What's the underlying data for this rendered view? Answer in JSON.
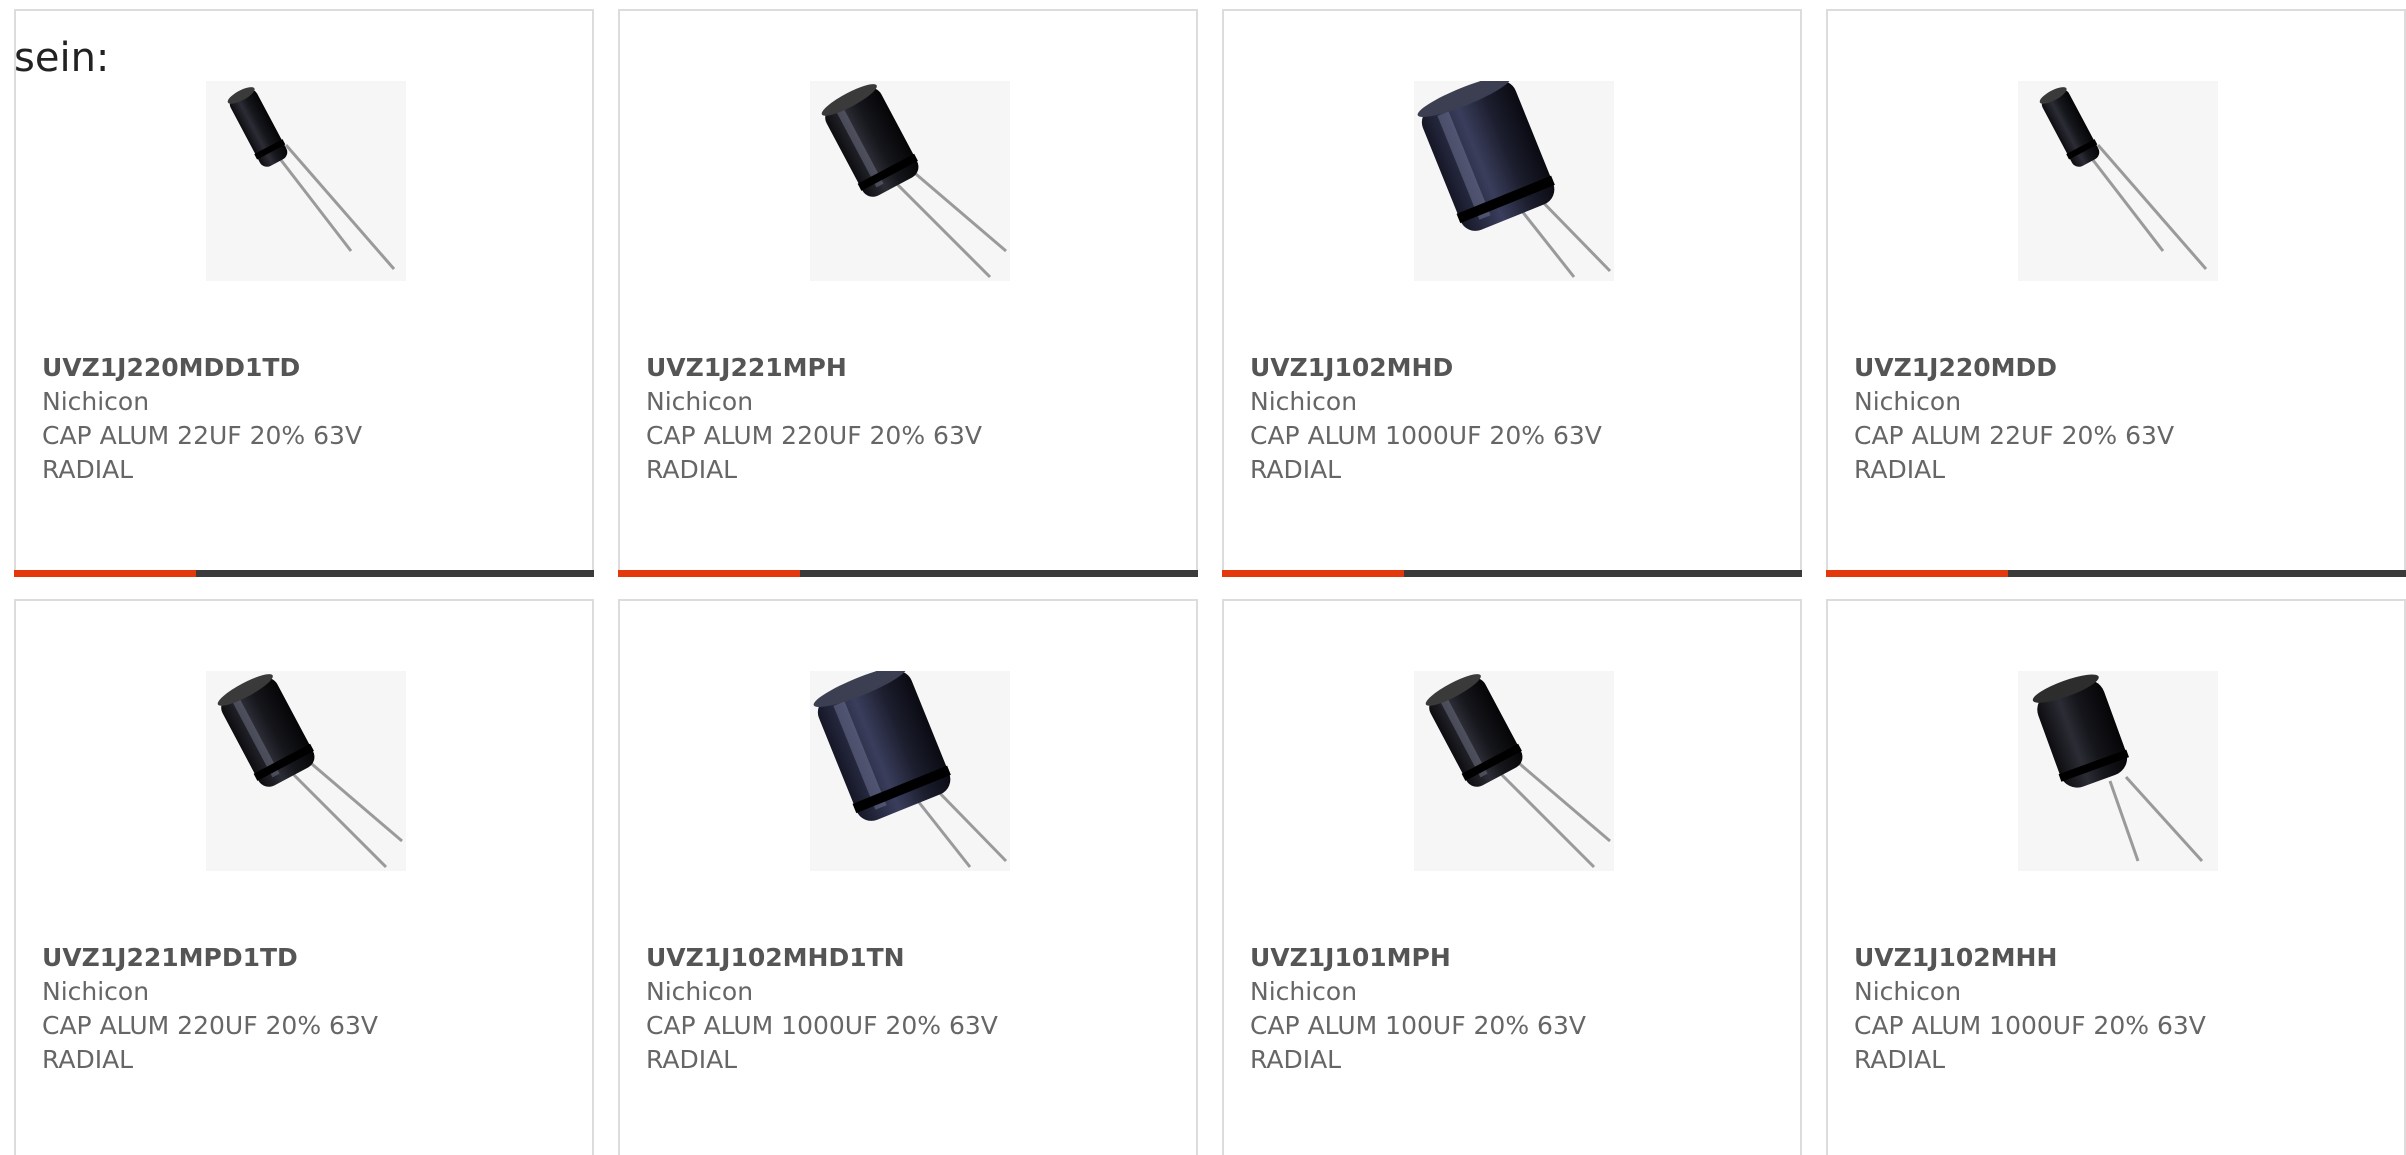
{
  "intro_text": "sein:",
  "colors": {
    "accent": "#e3380e",
    "bar_dark": "#3b3b3b",
    "card_border": "#dcdcdc"
  },
  "products": [
    {
      "part_number": "UVZ1J220MDD1TD",
      "manufacturer": "Nichicon",
      "desc1": "CAP ALUM 22UF 20% 63V",
      "desc2": "RADIAL",
      "image": "small-capacitor-icon"
    },
    {
      "part_number": "UVZ1J221MPH",
      "manufacturer": "Nichicon",
      "desc1": "CAP ALUM 220UF 20% 63V",
      "desc2": "RADIAL",
      "image": "medium-capacitor-icon"
    },
    {
      "part_number": "UVZ1J102MHD",
      "manufacturer": "Nichicon",
      "desc1": "CAP ALUM 1000UF 20% 63V",
      "desc2": "RADIAL",
      "image": "large-capacitor-icon"
    },
    {
      "part_number": "UVZ1J220MDD",
      "manufacturer": "Nichicon",
      "desc1": "CAP ALUM 22UF 20% 63V",
      "desc2": "RADIAL",
      "image": "small-capacitor-icon"
    },
    {
      "part_number": "UVZ1J221MPD1TD",
      "manufacturer": "Nichicon",
      "desc1": "CAP ALUM 220UF 20% 63V",
      "desc2": "RADIAL",
      "image": "medium-capacitor-icon"
    },
    {
      "part_number": "UVZ1J102MHD1TN",
      "manufacturer": "Nichicon",
      "desc1": "CAP ALUM 1000UF 20% 63V",
      "desc2": "RADIAL",
      "image": "large-capacitor-icon"
    },
    {
      "part_number": "UVZ1J101MPH",
      "manufacturer": "Nichicon",
      "desc1": "CAP ALUM 100UF 20% 63V",
      "desc2": "RADIAL",
      "image": "medium-capacitor-icon"
    },
    {
      "part_number": "UVZ1J102MHH",
      "manufacturer": "Nichicon",
      "desc1": "CAP ALUM 1000UF 20% 63V",
      "desc2": "RADIAL",
      "image": "plain-capacitor-icon"
    }
  ]
}
